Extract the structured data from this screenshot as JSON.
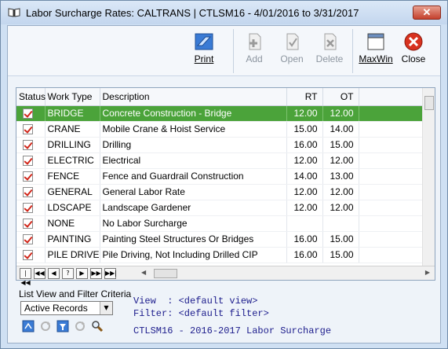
{
  "window": {
    "title": "Labor Surcharge Rates: CALTRANS | CTLSM16 -  4/01/2016 to  3/31/2017",
    "close_glyph": "✕"
  },
  "toolbar": {
    "print": "Print",
    "add": "Add",
    "open": "Open",
    "delete": "Delete",
    "maxwin": "MaxWin",
    "close": "Close"
  },
  "grid": {
    "columns": [
      "Status",
      "Work Type",
      "Description",
      "RT",
      "OT"
    ],
    "rows": [
      {
        "work_type": "BRIDGE",
        "description": "Concrete Construction - Bridge",
        "rt": "12.00",
        "ot": "12.00",
        "selected": true
      },
      {
        "work_type": "CRANE",
        "description": "Mobile Crane & Hoist Service",
        "rt": "15.00",
        "ot": "14.00"
      },
      {
        "work_type": "DRILLING",
        "description": "Drilling",
        "rt": "16.00",
        "ot": "15.00"
      },
      {
        "work_type": "ELECTRIC",
        "description": "Electrical",
        "rt": "12.00",
        "ot": "12.00"
      },
      {
        "work_type": "FENCE",
        "description": "Fence and Guardrail Construction",
        "rt": "14.00",
        "ot": "13.00"
      },
      {
        "work_type": "GENERAL",
        "description": "General Labor Rate",
        "rt": "12.00",
        "ot": "12.00"
      },
      {
        "work_type": "LDSCAPE",
        "description": "Landscape Gardener",
        "rt": "12.00",
        "ot": "12.00"
      },
      {
        "work_type": "NONE",
        "description": "No Labor Surcharge",
        "rt": "",
        "ot": ""
      },
      {
        "work_type": "PAINTING",
        "description": "Painting Steel Structures Or Bridges",
        "rt": "16.00",
        "ot": "15.00"
      },
      {
        "work_type": "PILE DRIVE",
        "description": "Pile Driving, Not Including Drilled CIP",
        "rt": "16.00",
        "ot": "15.00"
      }
    ]
  },
  "nav": {
    "first": "|◀◀",
    "prev_page": "◀◀",
    "prev": "◀",
    "help": "?",
    "next": "▶",
    "next_page": "▶▶",
    "last": "▶▶|",
    "scroll_left": "◀",
    "scroll_right": "▶"
  },
  "filter": {
    "title": "List View and Filter Criteria",
    "selected": "Active Records",
    "view_line": "View  : <default view>",
    "filter_line": "Filter: <default filter>",
    "desc_line": "CTLSM16 - 2016-2017 Labor Surcharge"
  },
  "colors": {
    "selected_row": "#4ba33a",
    "check": "#d0261a",
    "info_text": "#1c1c8c"
  }
}
